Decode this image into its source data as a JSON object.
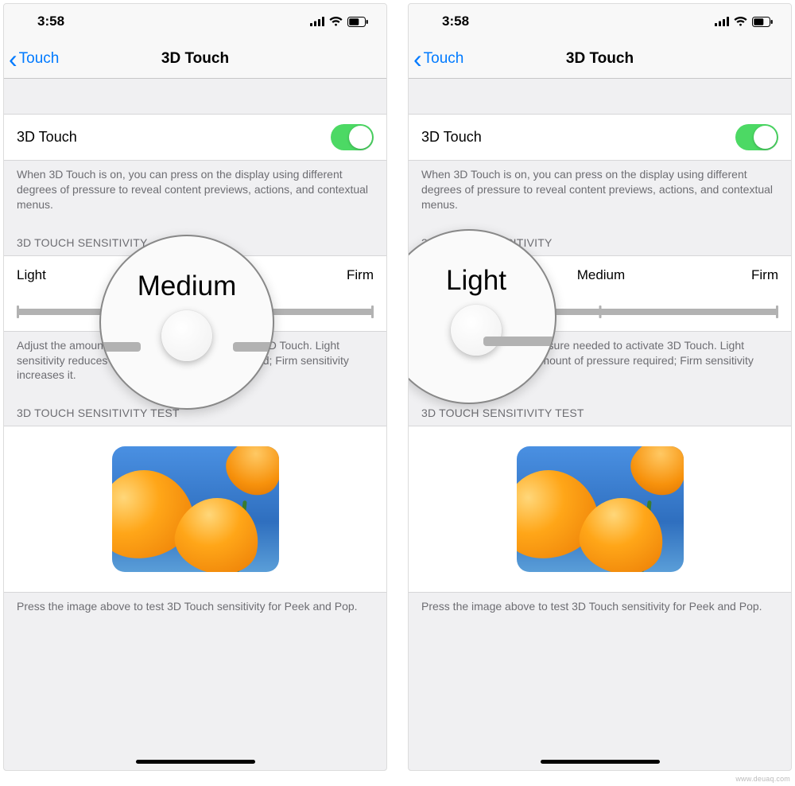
{
  "status": {
    "time": "3:58"
  },
  "nav": {
    "back_label": "Touch",
    "title": "3D Touch"
  },
  "toggle_row": {
    "label": "3D Touch",
    "on": true
  },
  "toggle_footer": "When 3D Touch is on, you can press on the display using different degrees of pressure to reveal content previews, actions, and contextual menus.",
  "sensitivity": {
    "header": "3D TOUCH SENSITIVITY",
    "labels": {
      "light": "Light",
      "medium": "Medium",
      "firm": "Firm"
    },
    "footer": "Adjust the amount of pressure needed to activate 3D Touch. Light sensitivity reduces the amount of pressure required; Firm sensitivity increases it."
  },
  "test": {
    "header": "3D TOUCH SENSITIVITY TEST",
    "footer": "Press the image above to test 3D Touch sensitivity for Peek and Pop."
  },
  "left_screen": {
    "selected": "Medium",
    "thumb_pct": 50
  },
  "right_screen": {
    "selected": "Light",
    "thumb_pct": 0
  },
  "watermark": "www.deuaq.com",
  "colors": {
    "accent": "#007aff",
    "toggle_on": "#4cd964"
  }
}
